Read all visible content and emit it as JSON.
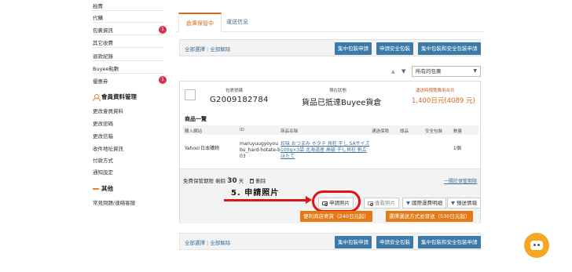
{
  "sidebar": {
    "items_top": [
      {
        "label": "拍賣"
      },
      {
        "label": "代購"
      },
      {
        "label": "包裹資訊",
        "badge": "1"
      },
      {
        "label": "其它收費"
      },
      {
        "label": "退款紀錄"
      },
      {
        "label": "Buyee點數"
      },
      {
        "label": "優惠券",
        "badge": "1"
      }
    ],
    "member_section": {
      "title": "會員資料管理",
      "items": [
        {
          "label": "更改會員資料"
        },
        {
          "label": "更改密碼"
        },
        {
          "label": "更改信箱"
        },
        {
          "label": "收件地址資訊"
        },
        {
          "label": "付款方式"
        },
        {
          "label": "通知設定"
        }
      ]
    },
    "other_section": {
      "title": "其他",
      "items": [
        {
          "label": "常見問題/連絡客服"
        }
      ]
    }
  },
  "tabs": [
    {
      "label": "倉庫保管中",
      "active": true
    },
    {
      "label": "運送信息",
      "active": false
    }
  ],
  "action_bar": {
    "select_all": "全部選擇",
    "deselect_all": "全部解除",
    "buttons": [
      "集中包裝申請",
      "申請安全包裝",
      "集中包裝和安全包裝申請"
    ],
    "buttons_bottom": [
      "集中包裝申請",
      "申請安全包裝",
      "集中包裝和安全包裝申請"
    ]
  },
  "filter": {
    "sort_up": "▲",
    "sort_down": "▼",
    "select_value": "所有的包裹"
  },
  "package": {
    "number_label": "包裹號碼",
    "number": "G2009182784",
    "status_label": "現在狀態",
    "status": "貨品已抵達Buyee貨倉",
    "fee_label": "運送時預覽費用合共",
    "fee": "1,400日元(4089 元)",
    "goods_title": "商品一覽",
    "table_headers": [
      "購入網站",
      "ID",
      "商品名稱",
      "通過保險",
      "總品",
      "安全包裝",
      "數量"
    ],
    "rows": [
      {
        "site": "Yahoo!日本購物",
        "id": "maruyuugyoyoubu_hard-hotate-b03",
        "name": "珍味 おつまみ ホタテ 貝柱 干し SAサイズ 100g×3袋 北海道産 高級 干し貝柱 帆立 ほたて",
        "insurance": "",
        "item": "",
        "safe": "",
        "qty": "1個"
      }
    ],
    "period_label": "免費保管期限",
    "remaining_label": "剩餘",
    "remaining_days": "30",
    "days_unit": "天",
    "delete_label": "刪除",
    "period_link": "一關於保管期限",
    "pills": [
      "申請照片",
      "查看照片",
      "國際運費明細",
      "預送情報"
    ],
    "orange_buttons": [
      "便利商店寄貨（240日元起）",
      "選擇運送方式並發送（530日元起）"
    ]
  },
  "annotation": {
    "text": "5. 申請照片"
  },
  "colors": {
    "accent": "#d56b1b",
    "button_blue": "#3d7aa8",
    "button_orange": "#e47a16",
    "highlight_red": "#e01414",
    "badge_red": "#d9304c"
  }
}
